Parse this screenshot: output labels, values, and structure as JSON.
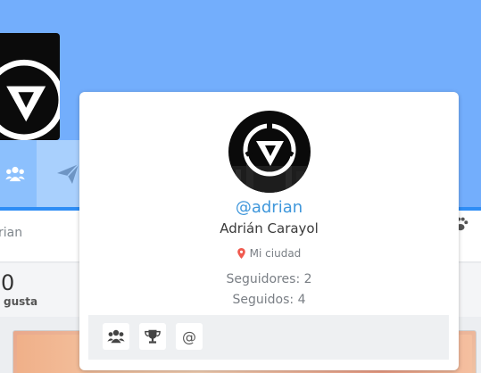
{
  "background_profile": {
    "name_partial": "rian",
    "stat_number": "0",
    "stat_label": "gusta"
  },
  "popover": {
    "handle": "@adrian",
    "full_name": "Adrián Carayol",
    "city": "Mi ciudad",
    "followers": "Seguidores: 2",
    "following": "Seguidos: 4",
    "actions": [
      {
        "icon": "users-icon"
      },
      {
        "icon": "trophy-icon"
      },
      {
        "icon": "at-icon",
        "glyph": "@"
      }
    ]
  },
  "colors": {
    "cover": "#73aefc",
    "accent": "#3f97db",
    "location_pin": "#f05a4f"
  }
}
